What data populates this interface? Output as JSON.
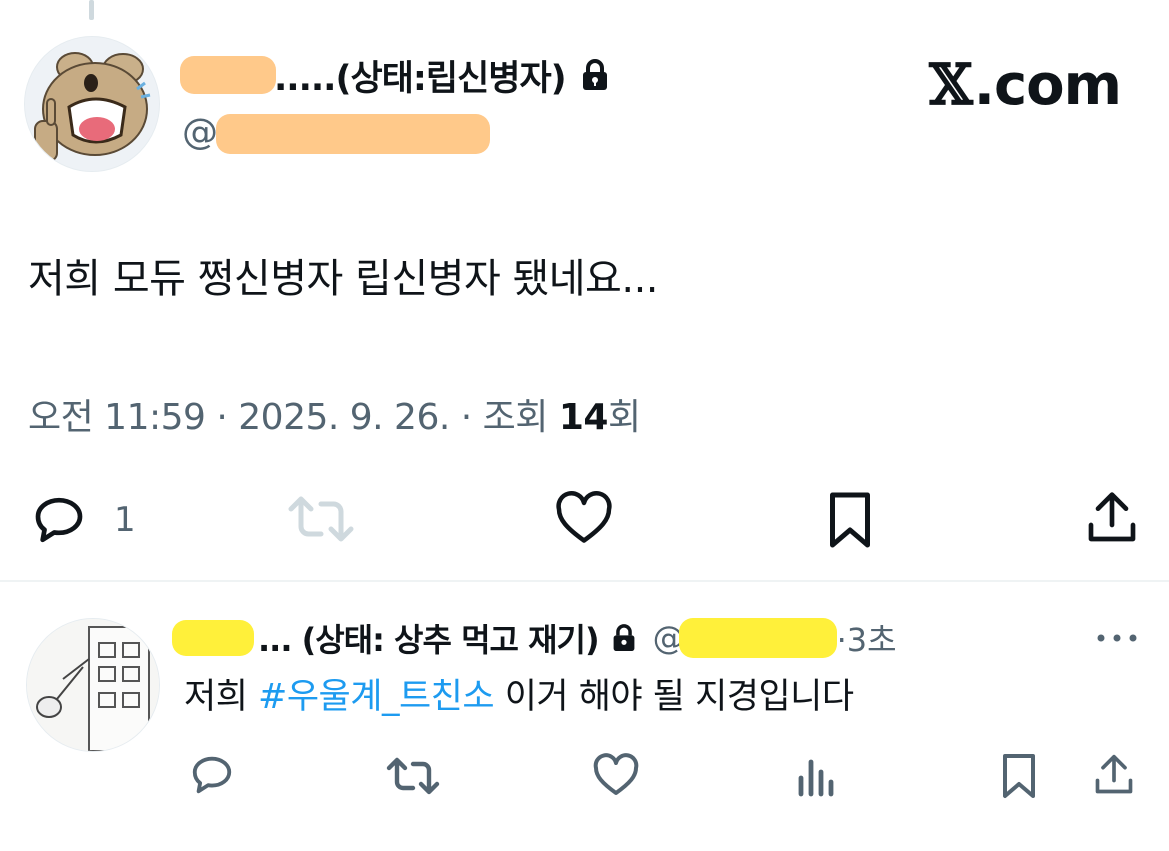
{
  "brand": {
    "x_glyph": "𝕏",
    "label": ".com"
  },
  "main_tweet": {
    "display_name": ".....(상태:립신병자)",
    "handle_prefix": "@",
    "text": "저희 모듀 쩡신병자 립신병자 됐네요...",
    "meta_prefix": "오전 11:59 · 2025. 9. 26. · 조회 ",
    "views": "14",
    "views_suffix": "회",
    "reply_count": "1",
    "icons": [
      "reply-icon",
      "retweet-icon",
      "like-icon",
      "bookmark-icon",
      "share-icon"
    ]
  },
  "reply_tweet": {
    "display_name": "... (상태: 상추 먹고 재기)",
    "handle_prefix": "@",
    "time": "·3초",
    "text_before": "저희 ",
    "hashtag": "#우울계_트친소",
    "text_after": " 이거 해야 될 지경입니다",
    "icons": [
      "reply-icon",
      "retweet-icon",
      "like-icon",
      "views-icon",
      "bookmark-icon",
      "share-icon"
    ]
  },
  "colors": {
    "text": "#0f1419",
    "secondary": "#536471",
    "disabled": "#cfd9de",
    "link": "#1d9bf0",
    "redaction_orange": "#ffc98a",
    "redaction_yellow": "#fff03a"
  }
}
